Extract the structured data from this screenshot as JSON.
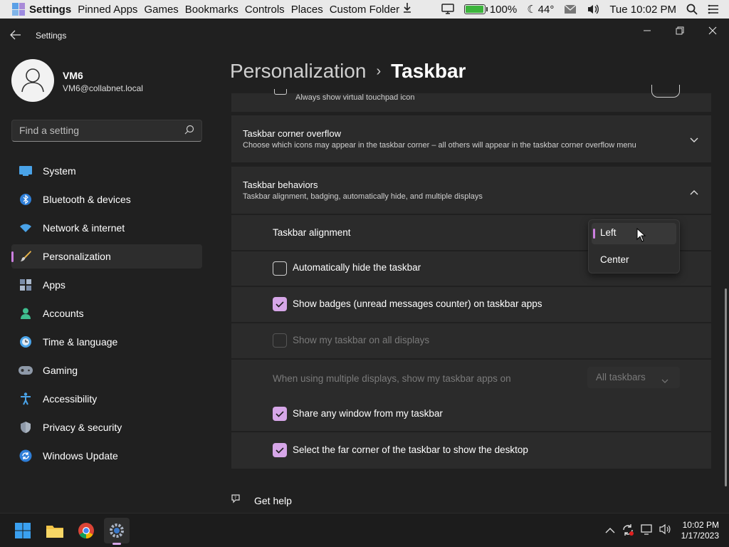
{
  "menubar": {
    "items": [
      "Settings",
      "Pinned Apps",
      "Games",
      "Bookmarks",
      "Controls",
      "Places",
      "Custom Folder"
    ],
    "battery_percent": "100%",
    "battery_level": 1.0,
    "weather": "44°",
    "datetime": "Tue 10:02 PM"
  },
  "window": {
    "title": "Settings"
  },
  "user": {
    "name": "VM6",
    "email": "VM6@collabnet.local"
  },
  "search": {
    "placeholder": "Find a setting"
  },
  "nav": [
    {
      "label": "System",
      "icon": "monitor-icon"
    },
    {
      "label": "Bluetooth & devices",
      "icon": "bluetooth-icon"
    },
    {
      "label": "Network & internet",
      "icon": "wifi-icon"
    },
    {
      "label": "Personalization",
      "icon": "brush-icon",
      "active": true
    },
    {
      "label": "Apps",
      "icon": "apps-icon"
    },
    {
      "label": "Accounts",
      "icon": "person-icon"
    },
    {
      "label": "Time & language",
      "icon": "clock-globe-icon"
    },
    {
      "label": "Gaming",
      "icon": "gamepad-icon"
    },
    {
      "label": "Accessibility",
      "icon": "accessibility-icon"
    },
    {
      "label": "Privacy & security",
      "icon": "shield-icon"
    },
    {
      "label": "Windows Update",
      "icon": "update-icon"
    }
  ],
  "breadcrumb": {
    "parent": "Personalization",
    "separator": "›",
    "current": "Taskbar"
  },
  "partial_row": {
    "description": "Always show virtual touchpad icon"
  },
  "corner_overflow": {
    "title": "Taskbar corner overflow",
    "description": "Choose which icons may appear in the taskbar corner – all others will appear in the taskbar corner overflow menu"
  },
  "behaviors": {
    "title": "Taskbar behaviors",
    "description": "Taskbar alignment, badging, automatically hide, and multiple displays",
    "alignment_label": "Taskbar alignment",
    "alignment_options": [
      "Left",
      "Center"
    ],
    "alignment_selected": "Left",
    "auto_hide": {
      "label": "Automatically hide the taskbar",
      "checked": false
    },
    "badges": {
      "label": "Show badges (unread messages counter) on taskbar apps",
      "checked": true
    },
    "all_displays": {
      "label": "Show my taskbar on all displays",
      "checked": false,
      "disabled": true
    },
    "multi_display": {
      "label": "When using multiple displays, show my taskbar apps on",
      "value": "All taskbars",
      "disabled": true
    },
    "share_window": {
      "label": "Share any window from my taskbar",
      "checked": true
    },
    "far_corner": {
      "label": "Select the far corner of the taskbar to show the desktop",
      "checked": true
    }
  },
  "help": {
    "label": "Get help"
  },
  "taskbar": {
    "time": "10:02 PM",
    "date": "1/17/2023"
  },
  "colors": {
    "accent": "#cc7fe0",
    "checkbox_on": "#d6a6e8",
    "background": "#202020",
    "card": "#2b2b2b"
  }
}
